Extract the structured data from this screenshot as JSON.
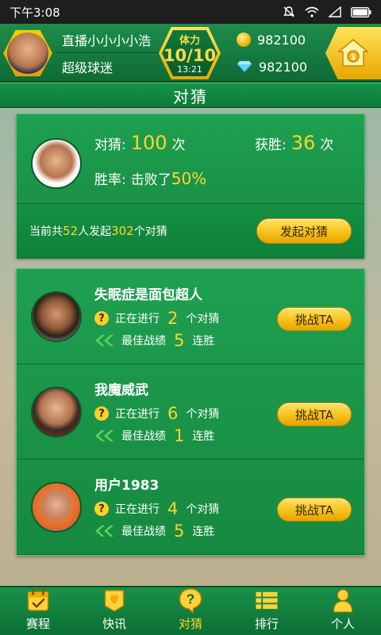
{
  "status_bar": {
    "time": "下午3:08"
  },
  "header": {
    "username": "直播小小小小浩",
    "user_title": "超级球迷",
    "stamina_label": "体力",
    "stamina_value": "10/10",
    "stamina_timer": "13:21",
    "coins": "982100",
    "gems": "982100"
  },
  "section_title": "对猜",
  "stats": {
    "bets_label": "对猜:",
    "bets_value": "100",
    "bets_unit": "次",
    "wins_label": "获胜:",
    "wins_value": "36",
    "wins_unit": "次",
    "winrate_label": "胜率:",
    "winrate_text": "击败了",
    "winrate_value": "50%",
    "summary_prefix": "当前共",
    "summary_people": "52",
    "summary_mid": "人发起",
    "summary_count": "302",
    "summary_suffix": "个对猜",
    "start_button": "发起对猜"
  },
  "challengers": [
    {
      "name": "失眠症是面包超人",
      "ongoing_label": "正在进行",
      "ongoing_value": "2",
      "ongoing_unit": "个对猜",
      "best_label": "最佳战绩",
      "best_value": "5",
      "best_unit": "连胜",
      "button": "挑战TA"
    },
    {
      "name": "我魔威武",
      "ongoing_label": "正在进行",
      "ongoing_value": "6",
      "ongoing_unit": "个对猜",
      "best_label": "最佳战绩",
      "best_value": "1",
      "best_unit": "连胜",
      "button": "挑战TA"
    },
    {
      "name": "用户1983",
      "ongoing_label": "正在进行",
      "ongoing_value": "4",
      "ongoing_unit": "个对猜",
      "best_label": "最佳战绩",
      "best_value": "5",
      "best_unit": "连胜",
      "button": "挑战TA"
    }
  ],
  "bottom_nav": [
    {
      "label": "赛程",
      "icon": "calendar-icon"
    },
    {
      "label": "快讯",
      "icon": "news-icon"
    },
    {
      "label": "对猜",
      "icon": "question-icon",
      "active": true
    },
    {
      "label": "排行",
      "icon": "ranking-icon"
    },
    {
      "label": "个人",
      "icon": "person-icon"
    }
  ]
}
